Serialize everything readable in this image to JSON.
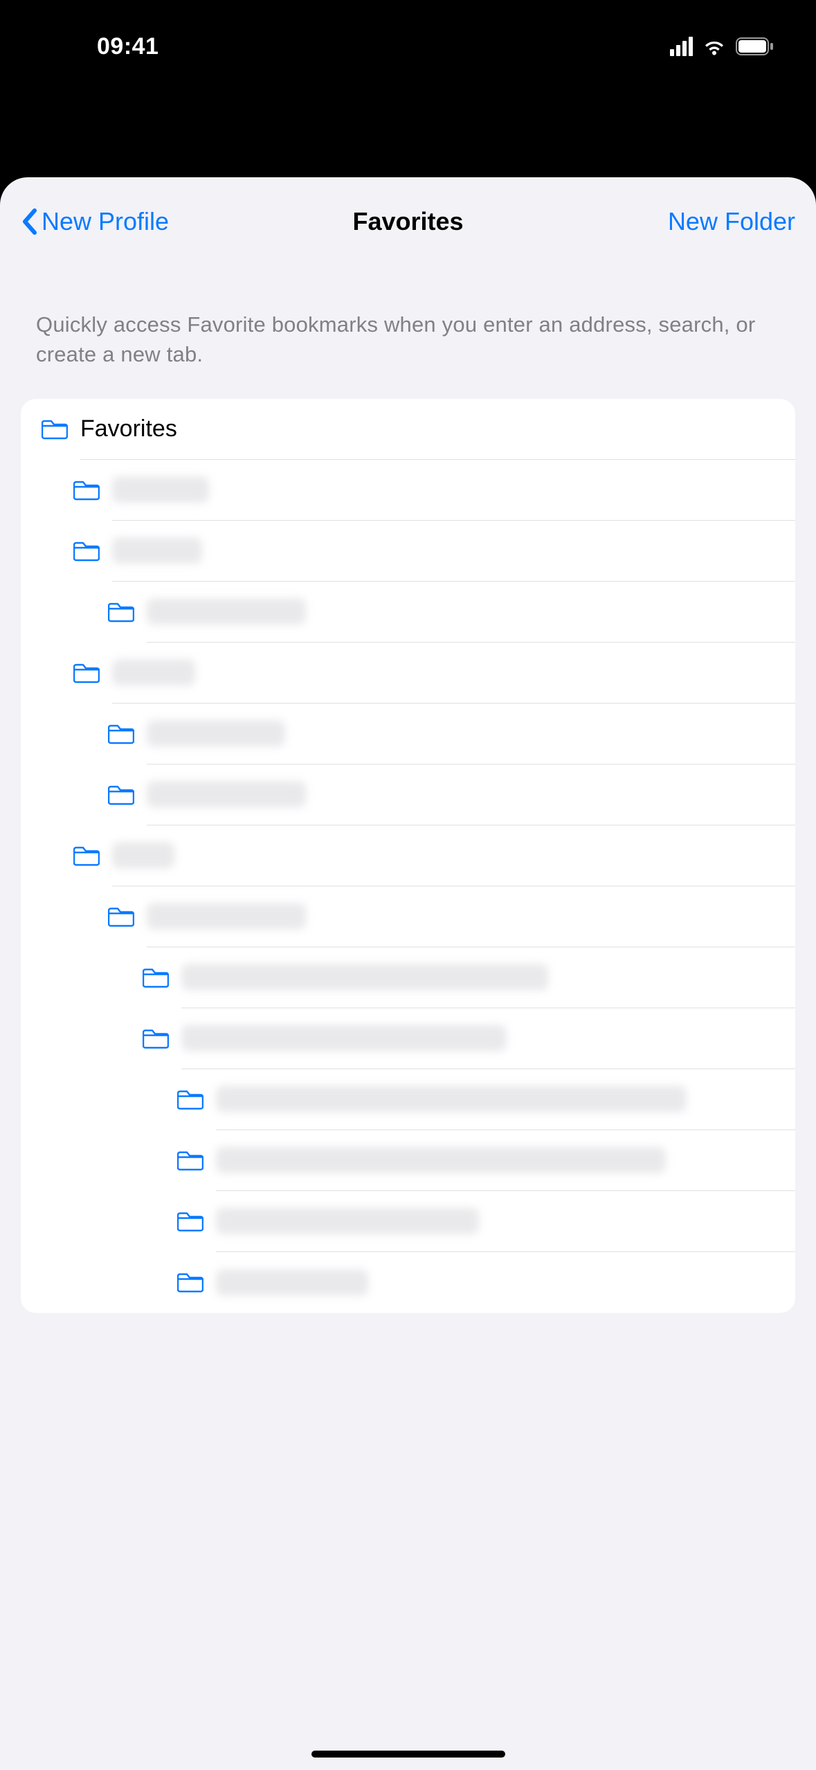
{
  "status": {
    "time": "09:41"
  },
  "nav": {
    "back_label": "New Profile",
    "title": "Favorites",
    "action_label": "New Folder"
  },
  "description": "Quickly access Favorite bookmarks when you enter an address, search, or create a new tab.",
  "folders": [
    {
      "indent": 0,
      "label": "Favorites",
      "obscured": false,
      "blur_w": 0
    },
    {
      "indent": 1,
      "label": "",
      "obscured": true,
      "blur_w": 140
    },
    {
      "indent": 1,
      "label": "",
      "obscured": true,
      "blur_w": 130
    },
    {
      "indent": 2,
      "label": "",
      "obscured": true,
      "blur_w": 230
    },
    {
      "indent": 1,
      "label": "",
      "obscured": true,
      "blur_w": 120
    },
    {
      "indent": 2,
      "label": "",
      "obscured": true,
      "blur_w": 200
    },
    {
      "indent": 2,
      "label": "",
      "obscured": true,
      "blur_w": 230
    },
    {
      "indent": 1,
      "label": "",
      "obscured": true,
      "blur_w": 90
    },
    {
      "indent": 2,
      "label": "",
      "obscured": true,
      "blur_w": 230
    },
    {
      "indent": 3,
      "label": "",
      "obscured": true,
      "blur_w": 530
    },
    {
      "indent": 3,
      "label": "",
      "obscured": true,
      "blur_w": 470
    },
    {
      "indent": 4,
      "label": "",
      "obscured": true,
      "blur_w": 680
    },
    {
      "indent": 4,
      "label": "",
      "obscured": true,
      "blur_w": 650
    },
    {
      "indent": 4,
      "label": "",
      "obscured": true,
      "blur_w": 380
    },
    {
      "indent": 4,
      "label": "",
      "obscured": true,
      "blur_w": 220
    }
  ],
  "colors": {
    "accent": "#0a7aff",
    "sheet_bg": "#f2f2f7"
  }
}
